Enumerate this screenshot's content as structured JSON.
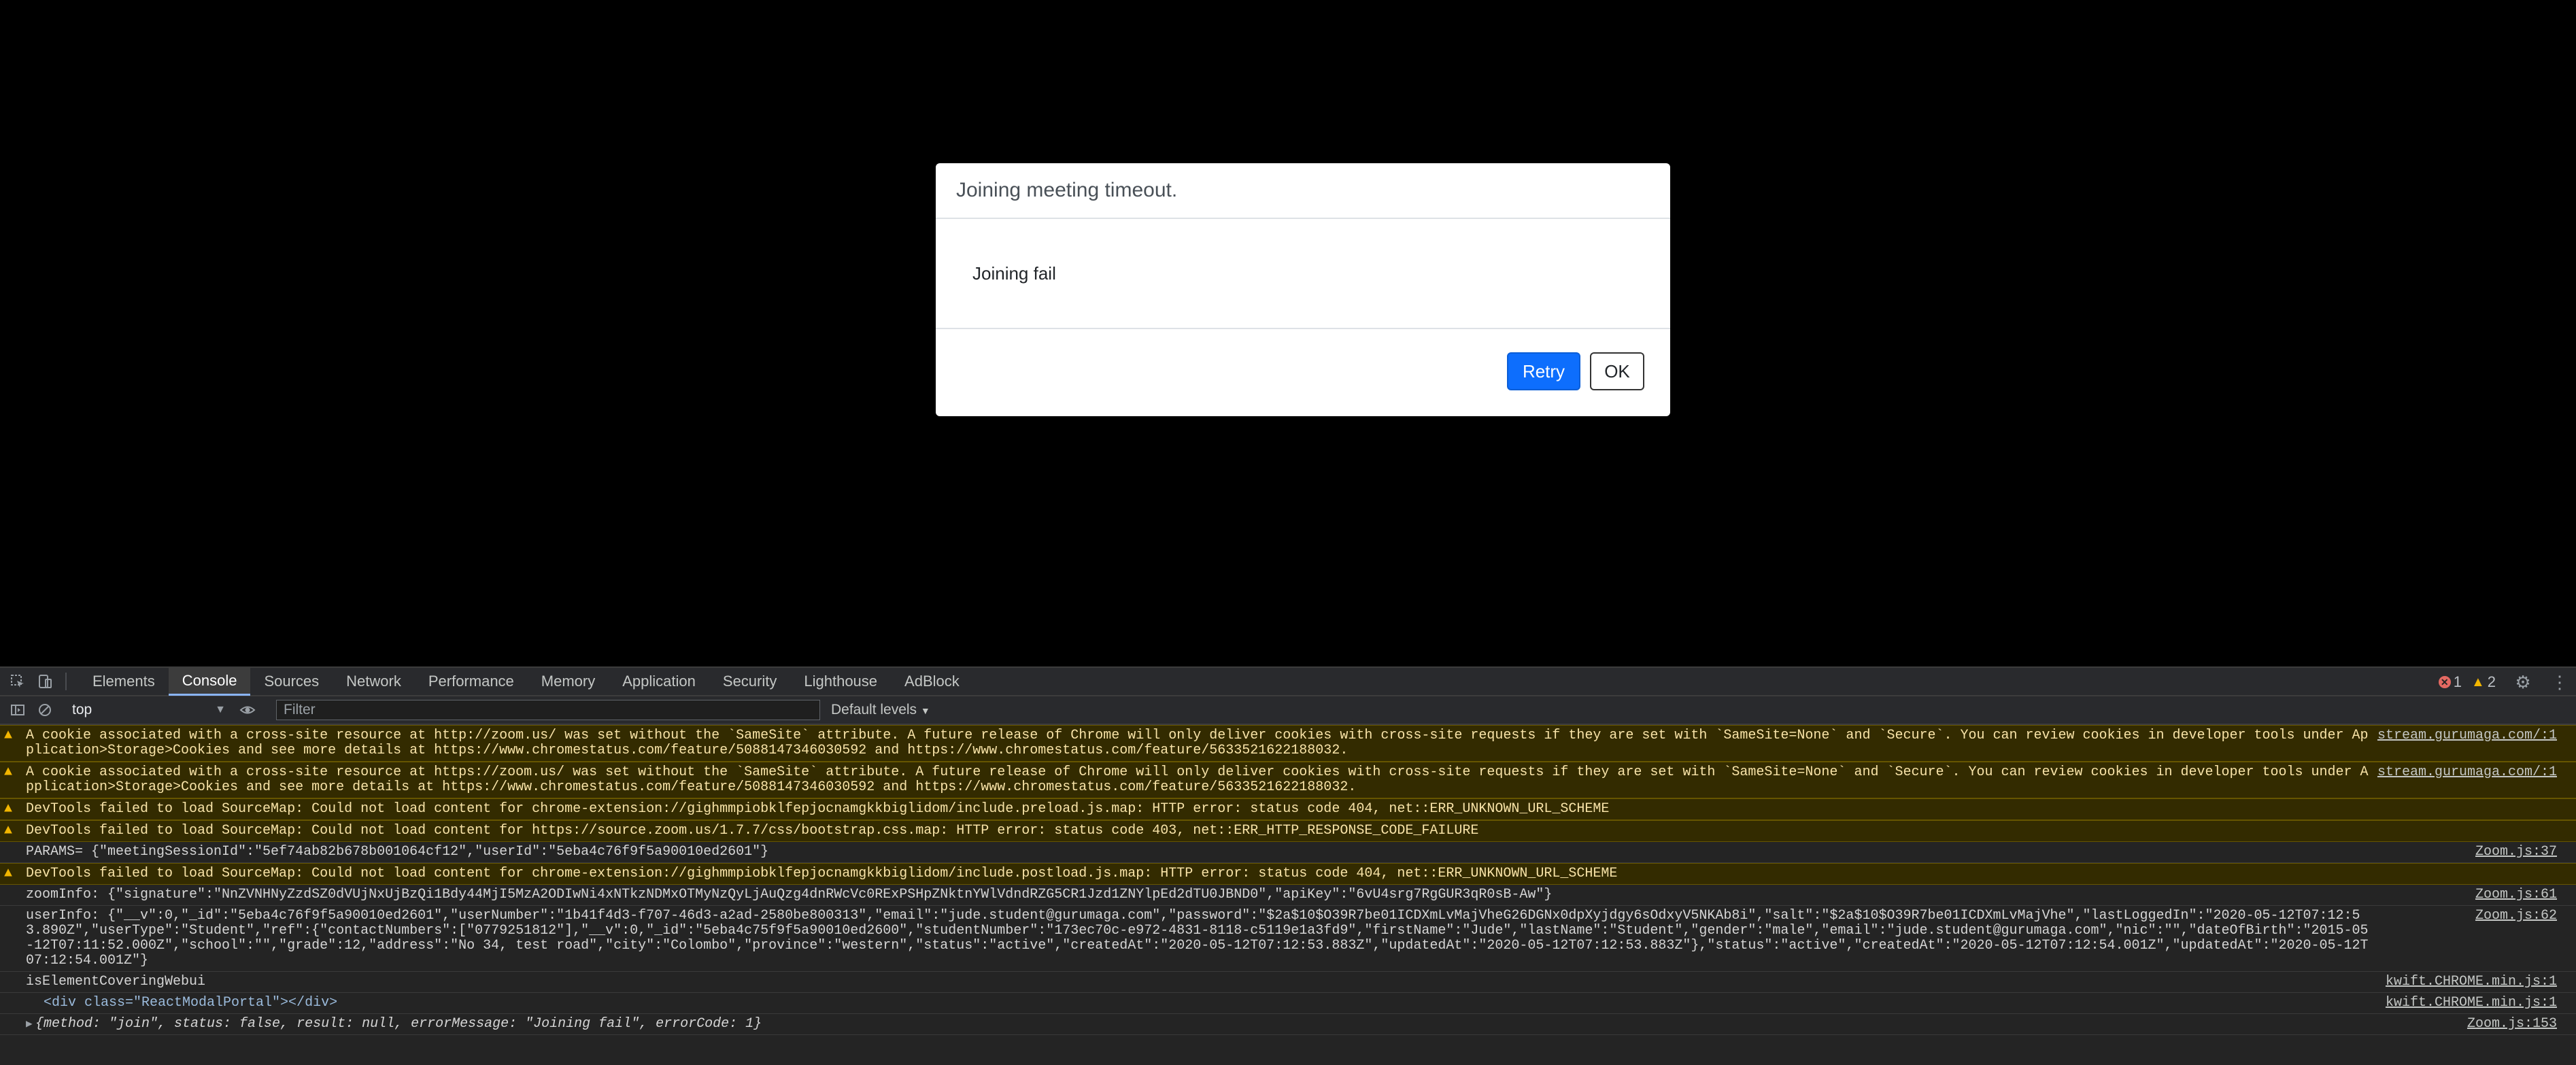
{
  "modal": {
    "title": "Joining meeting timeout.",
    "body": "Joining fail",
    "retry_label": "Retry",
    "ok_label": "OK"
  },
  "devtools": {
    "tabs": [
      "Elements",
      "Console",
      "Sources",
      "Network",
      "Performance",
      "Memory",
      "Application",
      "Security",
      "Lighthouse",
      "AdBlock"
    ],
    "active_tab": "Console",
    "error_count": "1",
    "warning_count": "2",
    "context": "top",
    "filter_placeholder": "Filter",
    "levels_label": "Default levels"
  },
  "console": {
    "messages": [
      {
        "type": "warn",
        "text": "A cookie associated with a cross-site resource at http://zoom.us/ was set without the `SameSite` attribute. A future release of Chrome will only deliver cookies with cross-site requests if they are set with `SameSite=None` and `Secure`. You can review cookies in developer tools under Application>Storage>Cookies and see more details at https://www.chromestatus.com/feature/5088147346030592 and https://www.chromestatus.com/feature/5633521622188032.",
        "source": "stream.gurumaga.com/:1"
      },
      {
        "type": "warn",
        "text": "A cookie associated with a cross-site resource at https://zoom.us/ was set without the `SameSite` attribute. A future release of Chrome will only deliver cookies with cross-site requests if they are set with `SameSite=None` and `Secure`. You can review cookies in developer tools under Application>Storage>Cookies and see more details at https://www.chromestatus.com/feature/5088147346030592 and https://www.chromestatus.com/feature/5633521622188032.",
        "source": "stream.gurumaga.com/:1"
      },
      {
        "type": "warn",
        "text": "DevTools failed to load SourceMap: Could not load content for chrome-extension://gighmmpiobklfepjocnamgkkbiglidom/include.preload.js.map: HTTP error: status code 404, net::ERR_UNKNOWN_URL_SCHEME",
        "source": ""
      },
      {
        "type": "warn",
        "text": "DevTools failed to load SourceMap: Could not load content for https://source.zoom.us/1.7.7/css/bootstrap.css.map: HTTP error: status code 403, net::ERR_HTTP_RESPONSE_CODE_FAILURE",
        "source": ""
      },
      {
        "type": "log",
        "text": "PARAMS= {\"meetingSessionId\":\"5ef74ab82b678b001064cf12\",\"userId\":\"5eba4c76f9f5a90010ed2601\"}",
        "source": "Zoom.js:37"
      },
      {
        "type": "warn",
        "text": "DevTools failed to load SourceMap: Could not load content for chrome-extension://gighmmpiobklfepjocnamgkkbiglidom/include.postload.js.map: HTTP error: status code 404, net::ERR_UNKNOWN_URL_SCHEME",
        "source": ""
      },
      {
        "type": "log",
        "text": "zoomInfo: {\"signature\":\"NnZVNHNyZzdSZ0dVUjNxUjBzQi1Bdy44MjI5MzA2ODIwNi4xNTkzNDMxOTMyNzQyLjAuQzg4dnRWcVc0RExPSHpZNktnYWlVdndRZG5CR1Jzd1ZNYlpEd2dTU0JBND0\",\"apiKey\":\"6vU4srg7RgGUR3qR0sB-Aw\"}",
        "source": "Zoom.js:61"
      },
      {
        "type": "log",
        "text": "userInfo: {\"__v\":0,\"_id\":\"5eba4c76f9f5a90010ed2601\",\"userNumber\":\"1b41f4d3-f707-46d3-a2ad-2580be800313\",\"email\":\"jude.student@gurumaga.com\",\"password\":\"$2a$10$O39R7be01ICDXmLvMajVheG26DGNx0dpXyjdgy6sOdxyV5NKAb8i\",\"salt\":\"$2a$10$O39R7be01ICDXmLvMajVhe\",\"lastLoggedIn\":\"2020-05-12T07:12:53.890Z\",\"userType\":\"Student\",\"ref\":{\"contactNumbers\":[\"0779251812\"],\"__v\":0,\"_id\":\"5eba4c75f9f5a90010ed2600\",\"studentNumber\":\"173ec70c-e972-4831-8118-c5119e1a3fd9\",\"firstName\":\"Jude\",\"lastName\":\"Student\",\"gender\":\"male\",\"email\":\"jude.student@gurumaga.com\",\"nic\":\"\",\"dateOfBirth\":\"2015-05-12T07:11:52.000Z\",\"school\":\"\",\"grade\":12,\"address\":\"No 34, test road\",\"city\":\"Colombo\",\"province\":\"western\",\"status\":\"active\",\"createdAt\":\"2020-05-12T07:12:53.883Z\",\"updatedAt\":\"2020-05-12T07:12:53.883Z\"},\"status\":\"active\",\"createdAt\":\"2020-05-12T07:12:54.001Z\",\"updatedAt\":\"2020-05-12T07:12:54.001Z\"}",
        "source": "Zoom.js:62"
      },
      {
        "type": "log",
        "text": "isElementCoveringWebui",
        "source": "kwift.CHROME.min.js:1"
      },
      {
        "type": "html",
        "text": "<div class=\"ReactModalPortal\"></div>",
        "source": "kwift.CHROME.min.js:1"
      },
      {
        "type": "obj",
        "text": "{method: \"join\", status: false, result: null, errorMessage: \"Joining fail\", errorCode: 1}",
        "source": "Zoom.js:153"
      }
    ]
  }
}
